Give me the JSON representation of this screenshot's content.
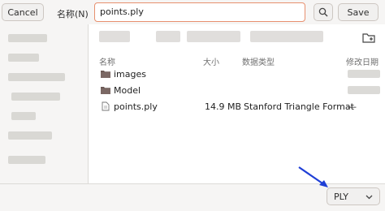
{
  "header": {
    "cancel_label": "Cancel",
    "name_label": "名称(N)",
    "filename_value": "points.ply",
    "search_icon": "search-icon",
    "save_label": "Save"
  },
  "columns": {
    "name": "名称",
    "size": "大小",
    "type": "数据类型",
    "modified": "修改日期"
  },
  "files": [
    {
      "label": "images",
      "icon": "folder-icon",
      "size": "",
      "type": "",
      "date": ""
    },
    {
      "label": "Model",
      "icon": "folder-icon",
      "size": "",
      "type": "",
      "date": ""
    },
    {
      "label": "points.ply",
      "icon": "file-icon",
      "size": "14.9 MB",
      "type": "Stanford Triangle Format",
      "date": "—"
    }
  ],
  "filter": {
    "selected": "PLY"
  },
  "colors": {
    "accent_focus": "#e7906f",
    "folder": "#6c5a56",
    "arrow": "#1f3fd6"
  }
}
